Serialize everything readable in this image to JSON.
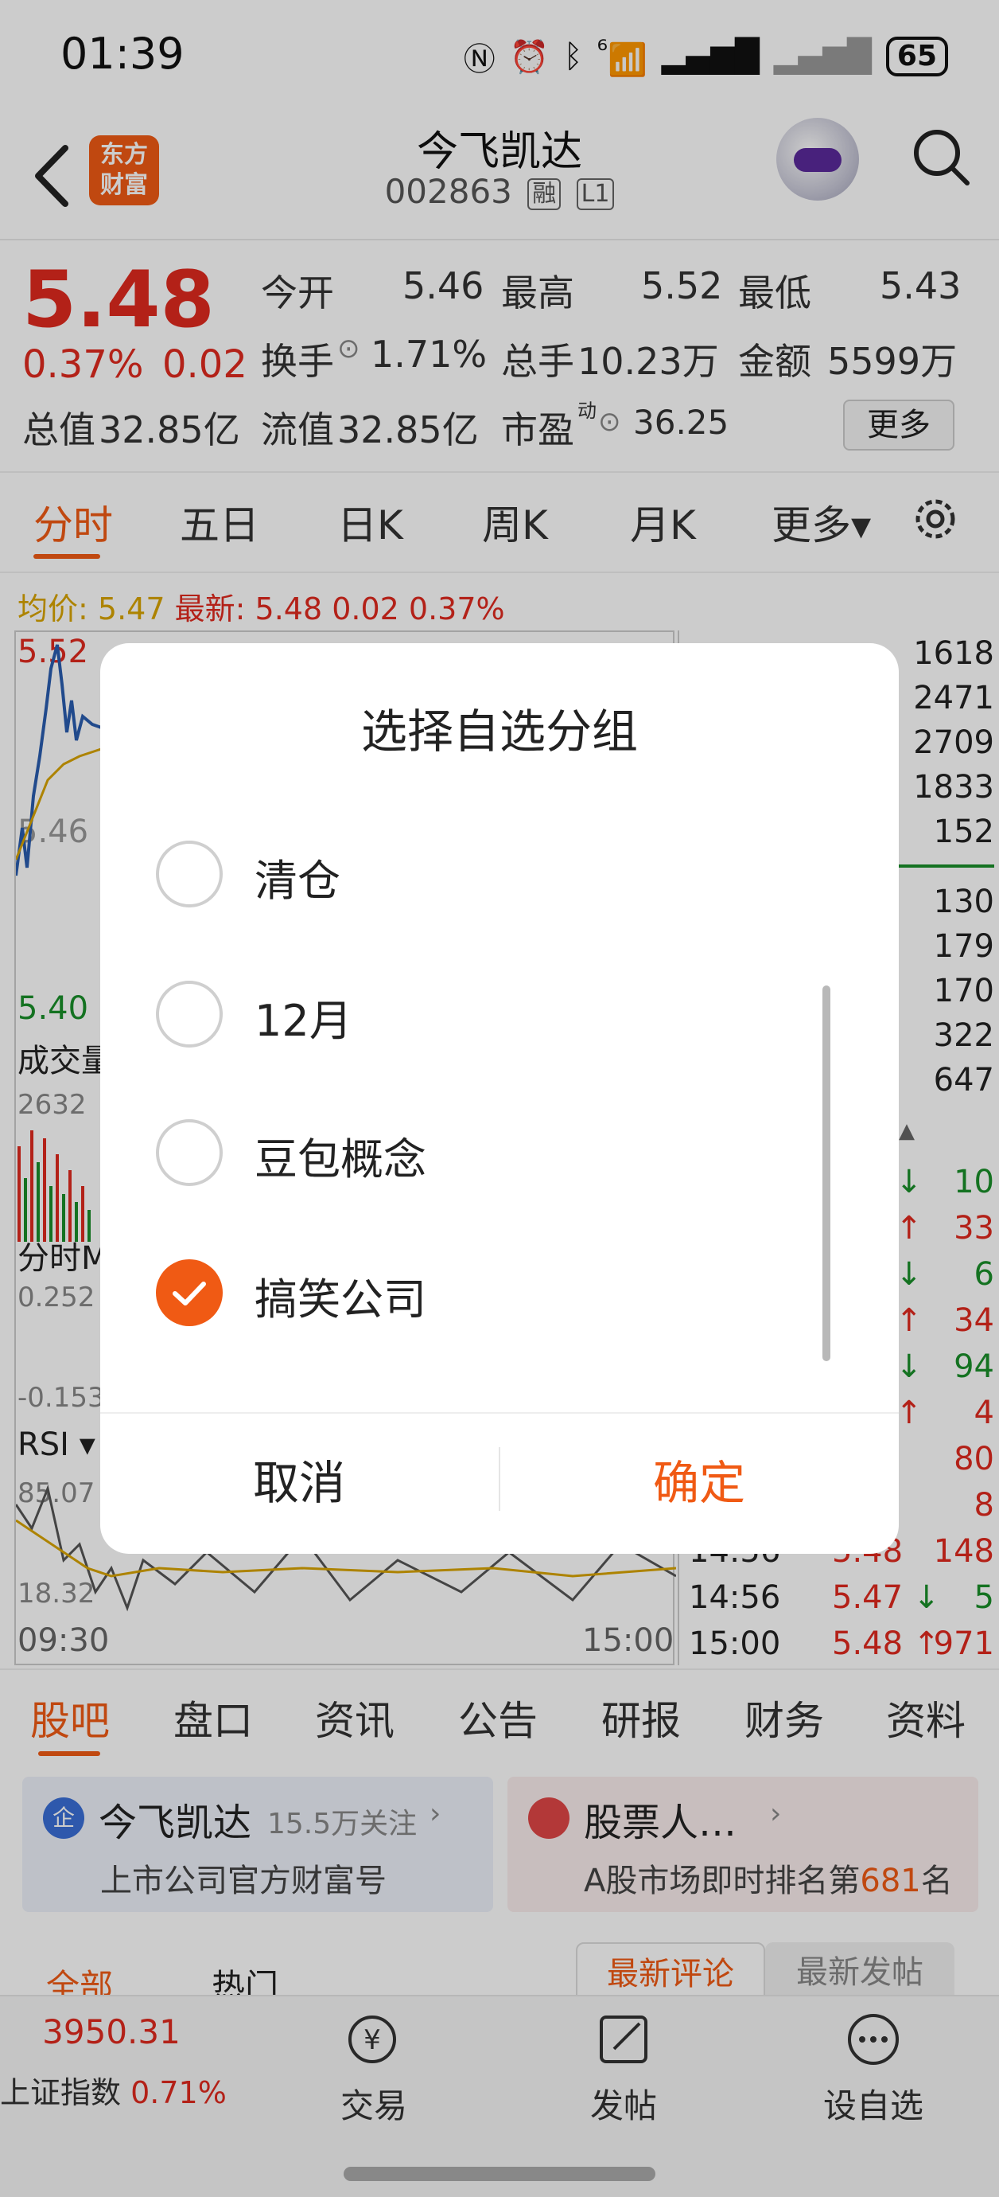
{
  "status_bar": {
    "time": "01:39",
    "battery": "65",
    "signal": "⁶"
  },
  "header": {
    "logo_text_1": "东方",
    "logo_text_2": "财富",
    "stock_name": "今飞凯达",
    "stock_code": "002863",
    "tag_margin": "融",
    "tag_level": "L1"
  },
  "quote": {
    "price": "5.48",
    "change_pct": "0.37%",
    "change": "0.02",
    "open_label": "今开",
    "open": "5.46",
    "high_label": "最高",
    "high": "5.52",
    "low_label": "最低",
    "low": "5.43",
    "turnover_label": "换手",
    "turnover": "1.71%",
    "volume_label": "总手",
    "volume": "10.23万",
    "amount_label": "金额",
    "amount": "5599万",
    "mcap_label": "总值",
    "mcap": "32.85亿",
    "float_label": "流值",
    "float": "32.85亿",
    "pe_label": "市盈",
    "pe_sup": "动",
    "pe": "36.25",
    "more_button": "更多"
  },
  "chart_tabs": [
    "分时",
    "五日",
    "日K",
    "周K",
    "月K",
    "更多▾"
  ],
  "chart_info": {
    "avg_label": "均价:",
    "avg": "5.47",
    "latest_label": "最新:",
    "latest": "5.48 0.02 0.37%",
    "y_high": "5.52",
    "y_mid": "5.46",
    "y_low": "5.40",
    "vol_label": "成交量",
    "vol_max": "2632",
    "indicator_label": "分时MACD",
    "macd_top": "0.252",
    "macd_bottom": "-0.153",
    "rsi_label": "RSI ▾",
    "rsi_top": "85.07",
    "rsi_bottom": "18.32",
    "time_start": "09:30",
    "time_end": "15:00"
  },
  "order_book_volumes": [
    "1618",
    "2471",
    "2709",
    "1833",
    "152",
    "130",
    "179",
    "170",
    "322",
    "647"
  ],
  "trades": [
    {
      "dir": "↓",
      "vol": "10"
    },
    {
      "dir": "↑",
      "vol": "33"
    },
    {
      "dir": "↓",
      "vol": "6"
    },
    {
      "dir": "↑",
      "vol": "34"
    },
    {
      "dir": "↓",
      "vol": "94"
    },
    {
      "dir": "↑",
      "vol": "4"
    },
    {
      "dir": "",
      "vol": "80"
    },
    {
      "dir": "",
      "vol": "8"
    },
    {
      "time": "14:56",
      "price": "5.48",
      "dir": "",
      "vol": "148"
    },
    {
      "time": "14:56",
      "price": "5.47",
      "dir": "↓",
      "vol": "5"
    },
    {
      "time": "15:00",
      "price": "5.48",
      "dir": "↑",
      "vol": "971"
    }
  ],
  "bottom_tabs": [
    "股吧",
    "盘口",
    "资讯",
    "公告",
    "研报",
    "财务",
    "资料"
  ],
  "cards": {
    "left_title": "今飞凯达",
    "left_followers": "15.5万关注",
    "left_sub": "上市公司官方财富号",
    "left_badge": "企",
    "right_title": "股票人…",
    "right_sub_prefix": "A股市场即时排名第",
    "right_rank": "681",
    "right_sub_suffix": "名"
  },
  "feed_tabs": {
    "all": "全部",
    "hot": "热门",
    "latest_comment": "最新评论",
    "latest_post": "最新发帖"
  },
  "footer": {
    "index_value": "3950.31",
    "index_label": "上证指数",
    "index_pct": "0.71%",
    "trade": "交易",
    "post": "发帖",
    "watchlist": "设自选"
  },
  "dialog": {
    "title": "选择自选分组",
    "options": [
      {
        "label": "清仓",
        "checked": false
      },
      {
        "label": "12月",
        "checked": false
      },
      {
        "label": "豆包概念",
        "checked": false
      },
      {
        "label": "搞笑公司",
        "checked": true
      }
    ],
    "cancel": "取消",
    "confirm": "确定"
  },
  "colors": {
    "accent": "#f05a14",
    "up": "#e02a1f",
    "down": "#1a8f2a",
    "avg_line": "#d9a400"
  }
}
